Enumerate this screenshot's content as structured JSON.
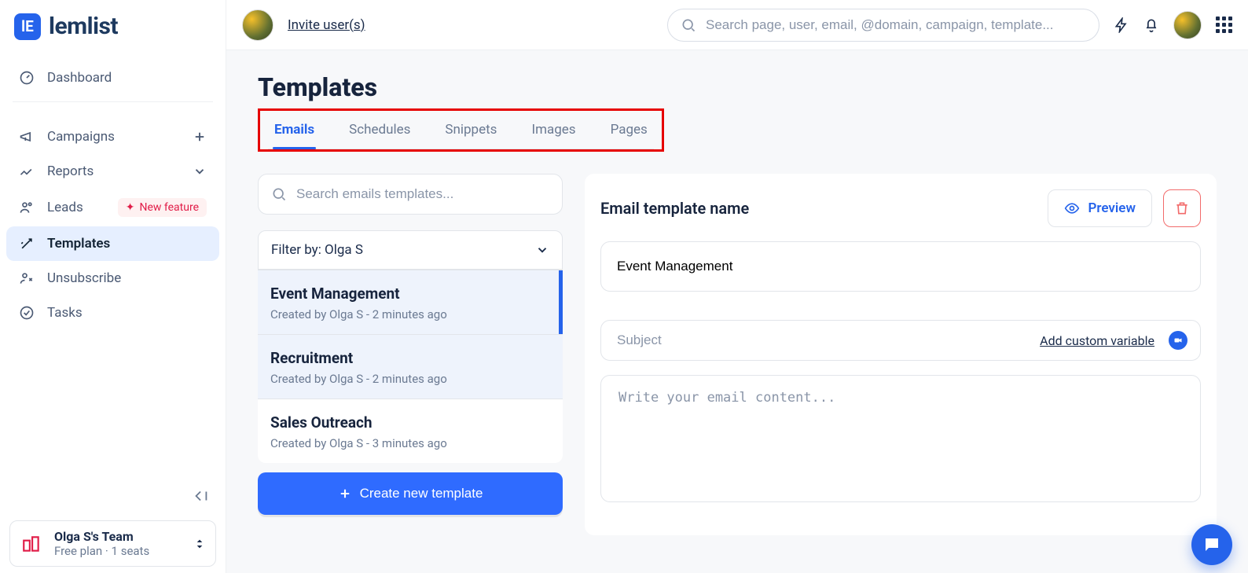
{
  "brand": {
    "logo_letter": "lE",
    "name": "lemlist"
  },
  "topbar": {
    "invite_label": "Invite user(s)",
    "search_placeholder": "Search page, user, email, @domain, campaign, template..."
  },
  "sidebar": {
    "items": [
      {
        "id": "dashboard",
        "label": "Dashboard"
      },
      {
        "id": "campaigns",
        "label": "Campaigns"
      },
      {
        "id": "reports",
        "label": "Reports"
      },
      {
        "id": "leads",
        "label": "Leads",
        "badge": "New feature"
      },
      {
        "id": "templates",
        "label": "Templates"
      },
      {
        "id": "unsubscribe",
        "label": "Unsubscribe"
      },
      {
        "id": "tasks",
        "label": "Tasks"
      }
    ],
    "team": {
      "name": "Olga S's Team",
      "plan": "Free plan · 1 seats"
    }
  },
  "page": {
    "title": "Templates",
    "tabs": [
      {
        "id": "emails",
        "label": "Emails"
      },
      {
        "id": "schedules",
        "label": "Schedules"
      },
      {
        "id": "snippets",
        "label": "Snippets"
      },
      {
        "id": "images",
        "label": "Images"
      },
      {
        "id": "pages",
        "label": "Pages"
      }
    ]
  },
  "templates_panel": {
    "search_placeholder": "Search emails templates...",
    "filter_label": "Filter by: Olga S",
    "items": [
      {
        "name": "Event Management",
        "meta": "Created by Olga S - 2 minutes ago",
        "selected": true
      },
      {
        "name": "Recruitment",
        "meta": "Created by Olga S - 2 minutes ago",
        "hover": true
      },
      {
        "name": "Sales Outreach",
        "meta": "Created by Olga S - 3 minutes ago"
      }
    ],
    "create_label": "Create new template"
  },
  "editor": {
    "heading": "Email template name",
    "preview_label": "Preview",
    "name_value": "Event Management",
    "subject_placeholder": "Subject",
    "add_variable_label": "Add custom variable",
    "body_placeholder": "Write your email content..."
  }
}
